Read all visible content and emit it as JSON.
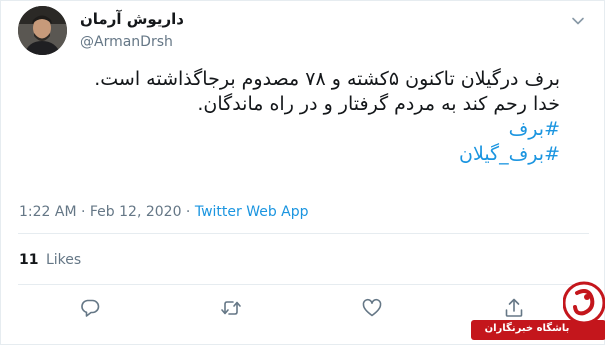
{
  "tweet": {
    "author": {
      "display_name": "داریوش آرمان",
      "handle": "@ArmanDrsh"
    },
    "text_lines": [
      "برف درگیلان تاکنون ۵کشته و ۷۸ مصدوم برجاگذاشته است.",
      "خدا رحم کند به مردم گرفتار و در راه ماندگان."
    ],
    "hashtags": [
      "#برف",
      "#برف_گیلان"
    ],
    "timestamp": "1:22 AM · Feb 12, 2020 · ",
    "source": "Twitter Web App",
    "likes": {
      "count": "11",
      "label": "Likes"
    },
    "icons": {
      "menu": "chevron-down-icon",
      "reply": "reply-icon",
      "retweet": "retweet-icon",
      "like": "heart-icon",
      "share": "share-icon"
    }
  },
  "watermark": {
    "text": "باشگاه خبرنگاران",
    "color": "#c4161c"
  },
  "colors": {
    "link": "#1b95e0",
    "secondary_text": "#657786",
    "border": "#e6ecf0",
    "primary_text": "#14171a"
  }
}
